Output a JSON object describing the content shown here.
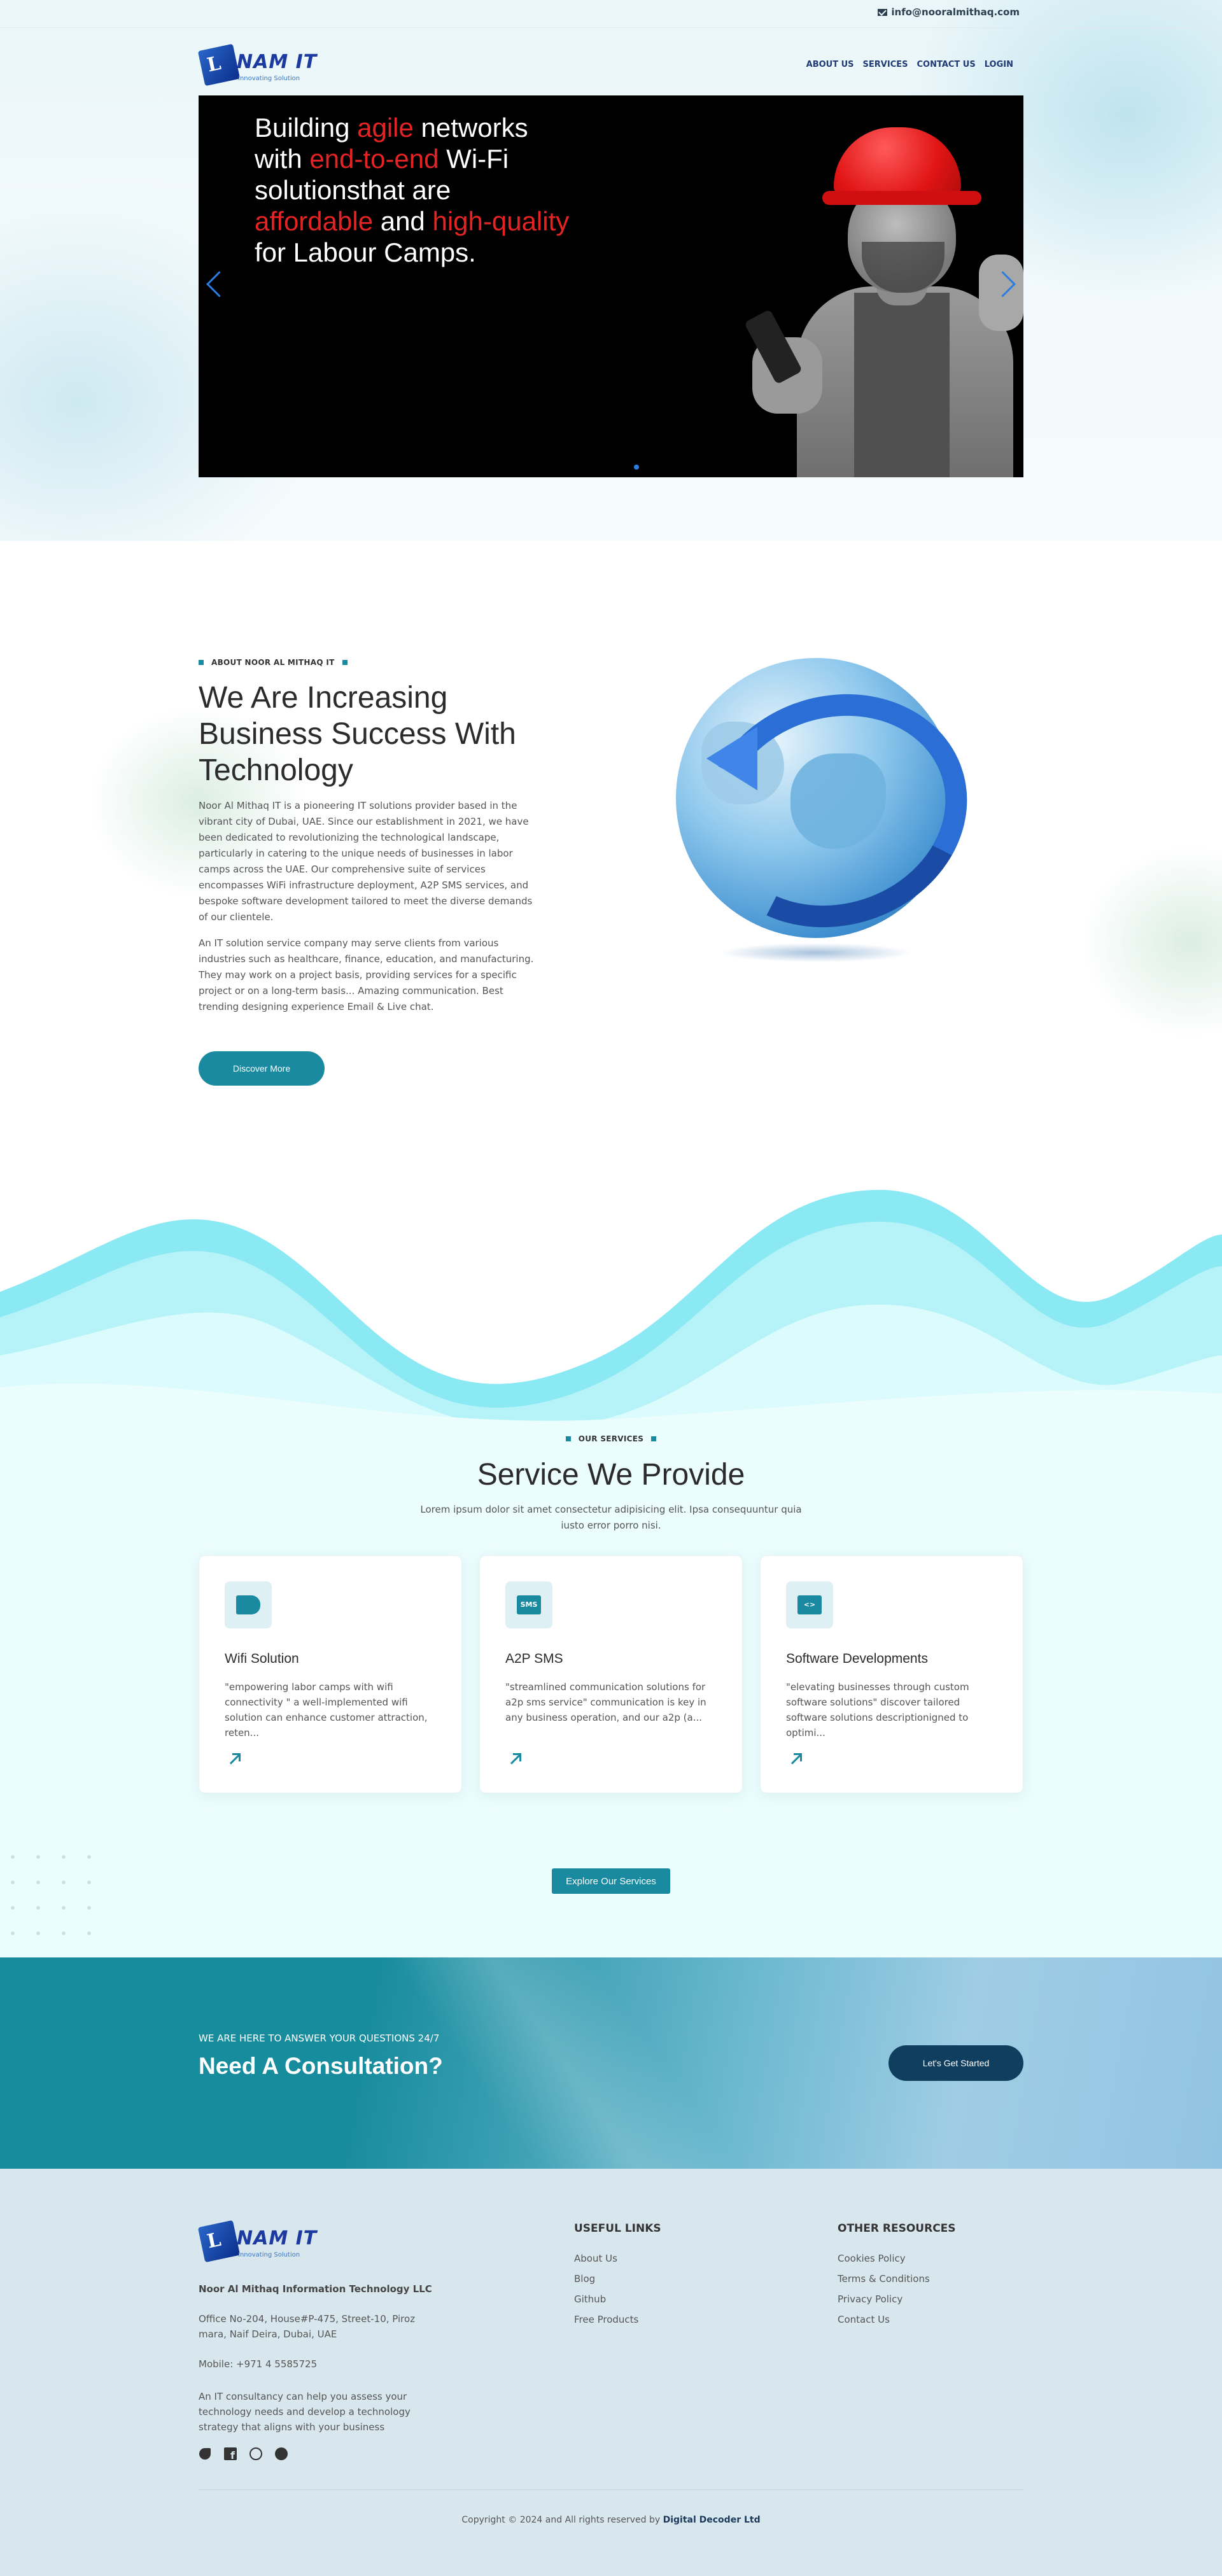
{
  "topbar": {
    "email": "info@nooralmithaq.com"
  },
  "brand": {
    "name": "NAM IT",
    "tagline": "Innovating Solution"
  },
  "nav": {
    "items": [
      "ABOUT US",
      "SERVICES",
      "CONTACT US",
      "LOGIN"
    ]
  },
  "hero": {
    "l1a": "Building ",
    "l1b": "agile",
    "l1c": " networks",
    "l2a": "with ",
    "l2b": "end-to-end",
    "l2c": " Wi-Fi",
    "l3": "solutionsthat are",
    "l4a": "affordable",
    "l4b": " and ",
    "l4c": "high-quality",
    "l5": "for Labour Camps.",
    "active_slide": 1
  },
  "about": {
    "eyebrow": "ABOUT NOOR AL MITHAQ IT",
    "title": "We Are Increasing Business Success With Technology",
    "p1": "Noor Al Mithaq IT is a pioneering IT solutions provider based in the vibrant city of Dubai, UAE. Since our establishment in 2021, we have been dedicated to revolutionizing the technological landscape, particularly in catering to the unique needs of businesses in labor camps across the UAE. Our comprehensive suite of services encompasses WiFi infrastructure deployment, A2P SMS services, and bespoke software development tailored to meet the diverse demands of our clientele.",
    "p2": "An IT solution service company may serve clients from various industries such as healthcare, finance, education, and manufacturing. They may work on a project basis, providing services for a specific project or on a long-term basis... Amazing communication. Best trending designing experience Email & Live chat.",
    "button": "Discover More"
  },
  "services": {
    "eyebrow": "OUR SERVICES",
    "title": "Service We Provide",
    "lead": "Lorem ipsum dolor sit amet consectetur adipisicing elit. Ipsa consequuntur quia iusto error porro nisi.",
    "cards": [
      {
        "icon": "megaphone-icon",
        "title": "Wifi Solution",
        "desc": "\"empowering labor camps with wifi connectivity \" a well-implemented wifi solution can enhance customer attraction, reten..."
      },
      {
        "icon": "sms-icon",
        "title": "A2P SMS",
        "desc": "\"streamlined communication solutions for a2p sms service\" communication is key in any business operation, and our a2p (a..."
      },
      {
        "icon": "laptop-code-icon",
        "title": "Software Developments",
        "desc": "\"elevating businesses through custom software solutions\" discover tailored software solutions descriptionigned to optimi..."
      }
    ],
    "sms_glyph": "SMS",
    "code_glyph": "<>",
    "button": "Explore Our Services"
  },
  "cta": {
    "kicker": "WE ARE HERE TO ANSWER YOUR QUESTIONS 24/7",
    "title": "Need A Consultation?",
    "button": "Let's Get Started"
  },
  "footer": {
    "company": "Noor Al Mithaq Information Technology LLC",
    "address": "Office No-204, House#P-475, Street-10, Piroz mara, Naif Deira, Dubai, UAE",
    "mobile": "Mobile: +971 4 5585725",
    "blurb": "An IT consultancy can help you assess your technology needs and develop a technology strategy that aligns with your business",
    "useful_title": "USEFUL LINKS",
    "useful": [
      "About Us",
      "Blog",
      "Github",
      "Free Products"
    ],
    "other_title": "OTHER RESOURCES",
    "other": [
      "Cookies Policy",
      "Terms & Conditions",
      "Privacy Policy",
      "Contact Us"
    ],
    "copyright": "Copyright © 2024 and All rights reserved by ",
    "copyright_owner": "Digital Decoder Ltd",
    "socials": [
      "twitter-icon",
      "facebook-icon",
      "dribbble-icon",
      "github-icon"
    ]
  },
  "colors": {
    "accent": "#1a8aa0",
    "hero_highlight": "#e42424",
    "nav": "#1f3a73",
    "cta_button": "#0f3e5e"
  }
}
